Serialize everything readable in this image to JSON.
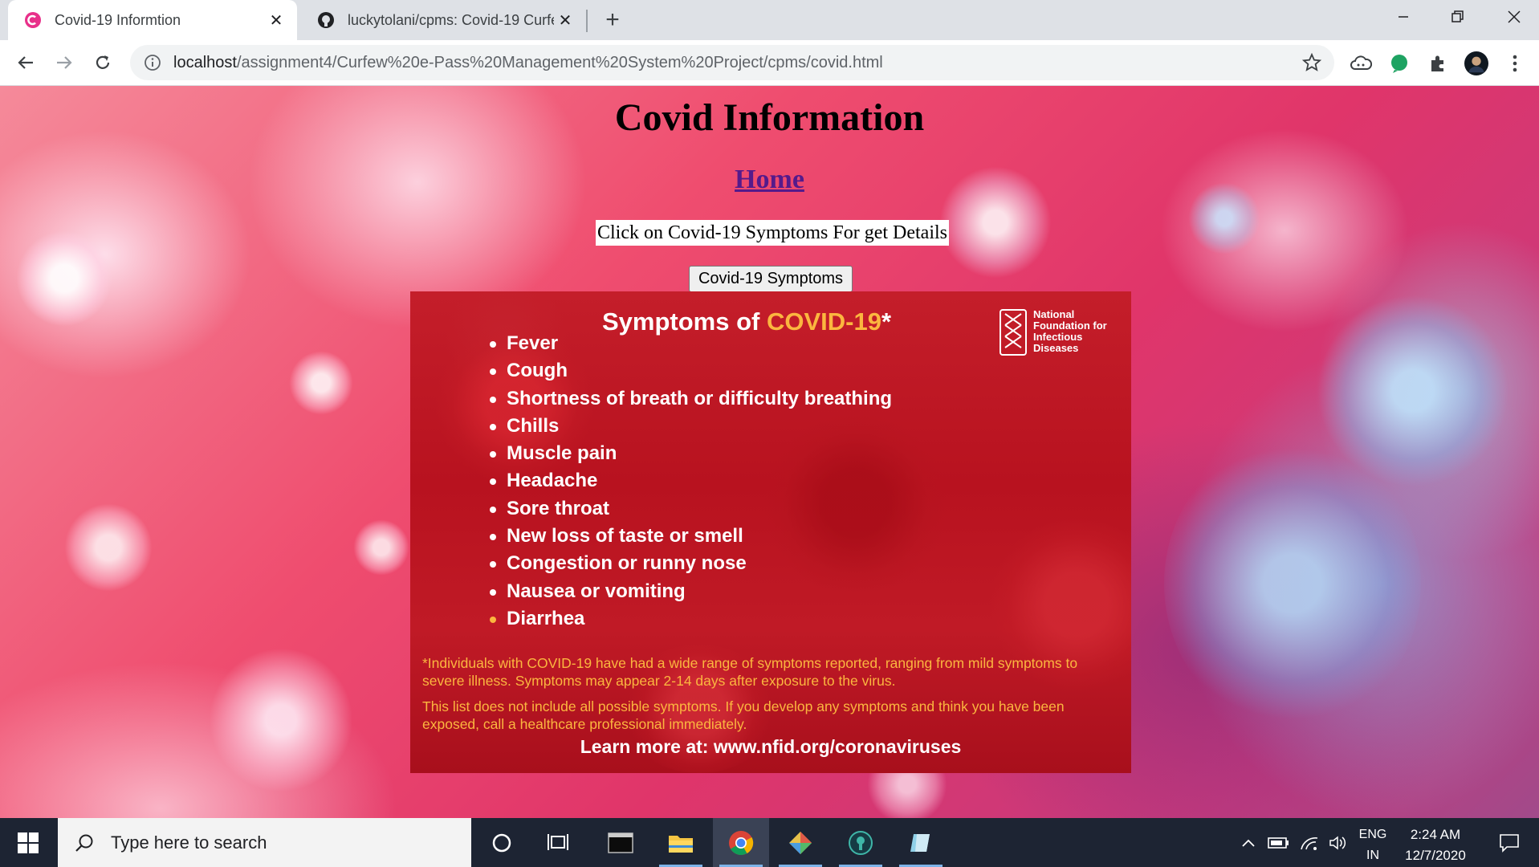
{
  "browser": {
    "tabs": [
      {
        "title": "Covid-19 Informtion",
        "active": true,
        "favicon": "c-shaped-pink-favicon-icon"
      },
      {
        "title": "luckytolani/cpms: Covid-19 Curfe",
        "active": false,
        "favicon": "github-icon"
      }
    ],
    "new_tab_label": "+",
    "url_host": "localhost",
    "url_path": "/assignment4/Curfew%20e-Pass%20Management%20System%20Project/cpms/covid.html"
  },
  "page": {
    "title": "Covid Information",
    "home_link": "Home",
    "prompt": "Click on Covid-19 Symptoms For get Details",
    "symptoms_button": "Covid-19 Symptoms"
  },
  "infographic": {
    "title_prefix": "Symptoms of ",
    "title_highlight": "COVID-19",
    "title_suffix": "*",
    "logo_lines": [
      "National",
      "Foundation for",
      "Infectious",
      "Diseases"
    ],
    "symptoms": [
      "Fever",
      "Cough",
      "Shortness of breath or difficulty breathing",
      "Chills",
      "Muscle pain",
      "Headache",
      "Sore throat",
      "New loss of taste or smell",
      "Congestion or runny nose",
      "Nausea or vomiting",
      "Diarrhea"
    ],
    "note1": "*Individuals with  COVID-19 have had a wide range of symptoms reported, ranging from mild symptoms to severe illness. Symptoms may appear 2-14 days after exposure to the virus.",
    "note2": "This list does not include all possible symptoms. If you develop any symptoms and think you have been exposed, call a healthcare professional immediately.",
    "learn_more": "Learn more at: www.nfid.org/coronaviruses",
    "colors": {
      "background": "#c41e2a",
      "highlight": "#fbb63f"
    }
  },
  "taskbar": {
    "search_placeholder": "Type here to search",
    "language_top": "ENG",
    "language_bottom": "IN",
    "time": "2:24 AM",
    "date": "12/7/2020"
  }
}
